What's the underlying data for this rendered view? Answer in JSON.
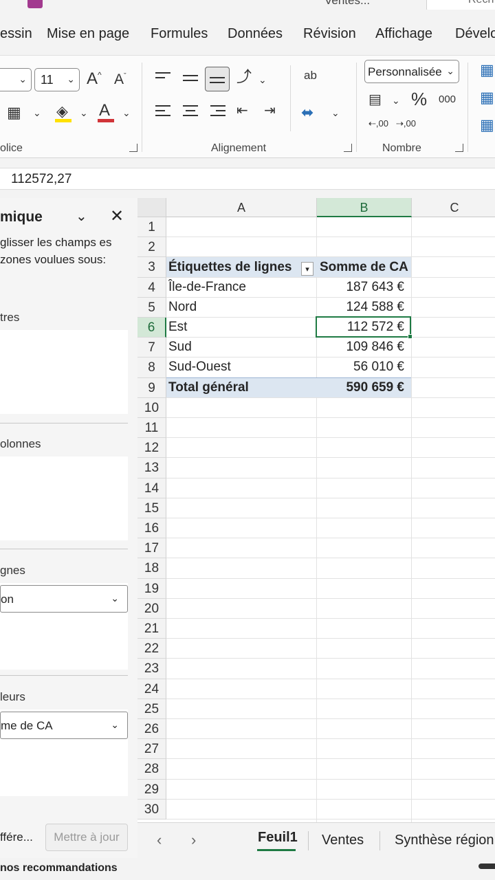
{
  "title_bar": {
    "file_title": "Ventes...",
    "search_placeholder": "Rech"
  },
  "ribbon_tabs": [
    "essin",
    "Mise en page",
    "Formules",
    "Données",
    "Révision",
    "Affichage",
    "Dévelo"
  ],
  "ribbon": {
    "font_size": "11",
    "grow_font": "A",
    "shrink_font": "A",
    "font_color_glyph": "A",
    "wrap_glyph": "ab",
    "number_format": "Personnalisée",
    "percent": "%",
    "thousands": "000",
    "dec_increase": ",00",
    "dec_decrease": ",00",
    "groups": {
      "font": "olice",
      "alignment": "Alignement",
      "number": "Nombre"
    },
    "colors": {
      "fill": "#ffe100",
      "font": "#d13438"
    }
  },
  "formula_bar": {
    "value": "112572,27"
  },
  "pivot_pane": {
    "title": "mique",
    "description": "glisser les champs es zones voulues sous:",
    "filters_label": "tres",
    "columns_label": "olonnes",
    "rows_label": "gnes",
    "rows_field": "on",
    "values_label": "leurs",
    "values_field": "me de CA",
    "defer_label": "ffére...",
    "update_button": "Mettre à jour"
  },
  "grid": {
    "columns": [
      "A",
      "B",
      "C"
    ],
    "rows": [
      "1",
      "2",
      "3",
      "4",
      "5",
      "6",
      "7",
      "8",
      "9",
      "10",
      "11",
      "12",
      "13",
      "14",
      "15",
      "16",
      "17",
      "18",
      "19",
      "20",
      "21",
      "22",
      "23",
      "24",
      "25",
      "26",
      "27",
      "28",
      "29",
      "30"
    ],
    "pivot_header": {
      "label": "Étiquettes de lignes",
      "value": "Somme de CA"
    },
    "pivot_rows": [
      {
        "label": "Île-de-France",
        "value": "187 643 €"
      },
      {
        "label": "Nord",
        "value": "124 588 €"
      },
      {
        "label": "Est",
        "value": "112 572 €"
      },
      {
        "label": "Sud",
        "value": "109 846 €"
      },
      {
        "label": "Sud-Ouest",
        "value": "56 010 €"
      }
    ],
    "total": {
      "label": "Total général",
      "value": "590 659 €"
    },
    "colors": {
      "band": "#dce6f1",
      "selection": "#1e7a43"
    }
  },
  "sheet_tabs": [
    "Feuil1",
    "Ventes",
    "Synthèse région"
  ],
  "bottom_text": "nos recommandations"
}
